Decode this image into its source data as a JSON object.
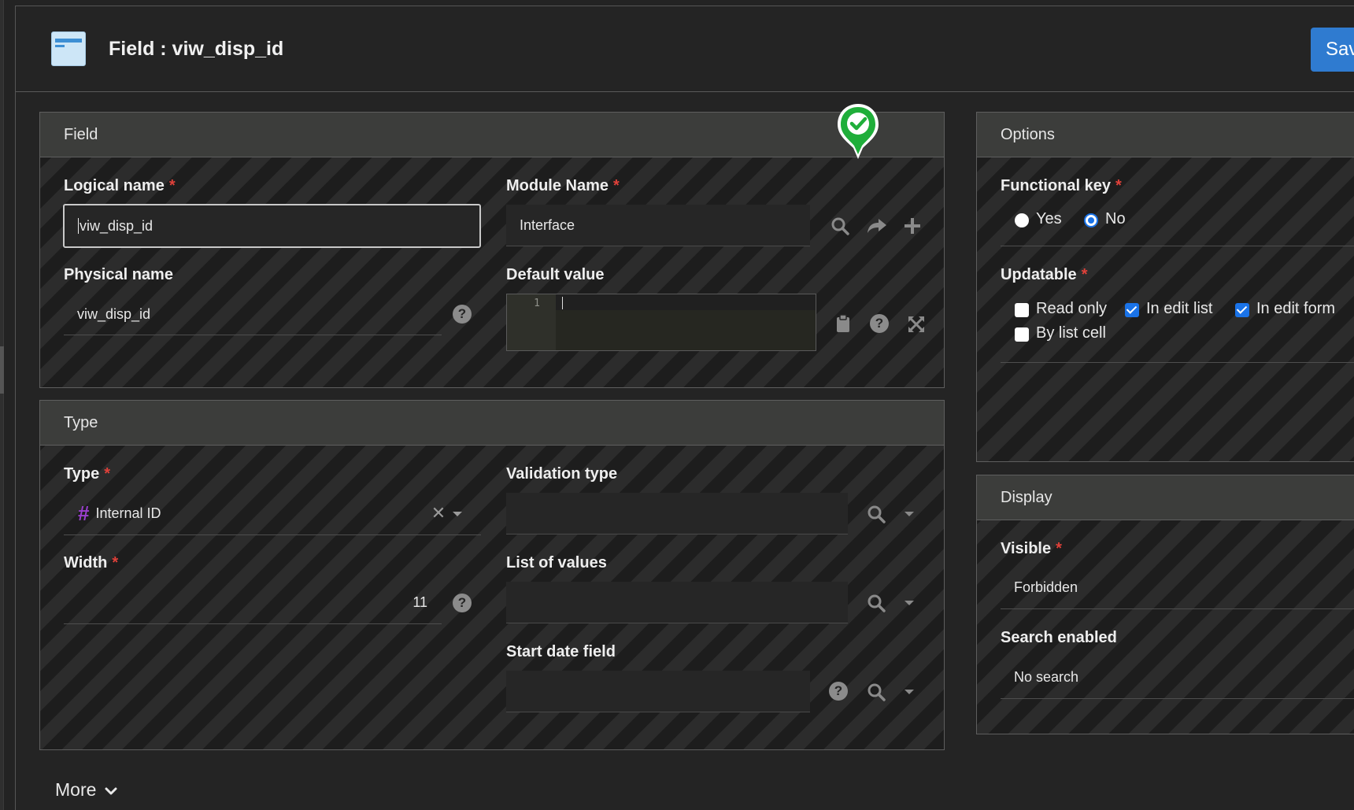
{
  "header": {
    "title": "Field : viw_disp_id",
    "save_label": "Sav"
  },
  "field_panel": {
    "title": "Field",
    "logical_name_label": "Logical name",
    "logical_name_value": "viw_disp_id",
    "module_name_label": "Module Name",
    "module_name_value": "Interface",
    "physical_name_label": "Physical name",
    "physical_name_value": "viw_disp_id",
    "default_value_label": "Default value",
    "default_value_line_number": "1",
    "required_mark": "*"
  },
  "type_panel": {
    "title": "Type",
    "type_label": "Type",
    "type_value": "Internal ID",
    "type_icon_glyph": "#",
    "validation_type_label": "Validation type",
    "width_label": "Width",
    "width_value": "11",
    "list_of_values_label": "List of values",
    "start_date_label": "Start date field",
    "required_mark": "*"
  },
  "options_panel": {
    "title": "Options",
    "functional_key_label": "Functional key",
    "yes_label": "Yes",
    "no_label": "No",
    "updatable_label": "Updatable",
    "read_only_label": "Read only",
    "in_edit_list_label": "In edit list",
    "in_edit_form_label": "In edit form",
    "by_list_cell_label": "By list cell",
    "required_mark": "*"
  },
  "display_panel": {
    "title": "Display",
    "visible_label": "Visible",
    "visible_value": "Forbidden",
    "search_enabled_label": "Search enabled",
    "search_enabled_value": "No search",
    "required_mark": "*"
  },
  "more_label": "More",
  "colors": {
    "accent": "#2f7bd0",
    "required": "#e0413a",
    "success": "#1fae3a",
    "type_icon": "#9b3fd0"
  }
}
